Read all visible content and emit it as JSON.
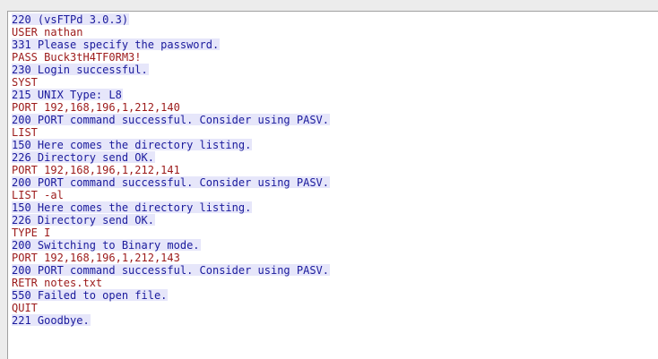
{
  "stream": {
    "lines": [
      {
        "dir": "server",
        "text": "220 (vsFTPd 3.0.3)"
      },
      {
        "dir": "client",
        "text": "USER nathan"
      },
      {
        "dir": "server",
        "text": "331 Please specify the password."
      },
      {
        "dir": "client",
        "text": "PASS Buck3tH4TF0RM3!"
      },
      {
        "dir": "server",
        "text": "230 Login successful."
      },
      {
        "dir": "client",
        "text": "SYST"
      },
      {
        "dir": "server",
        "text": "215 UNIX Type: L8"
      },
      {
        "dir": "client",
        "text": "PORT 192,168,196,1,212,140"
      },
      {
        "dir": "server",
        "text": "200 PORT command successful. Consider using PASV."
      },
      {
        "dir": "client",
        "text": "LIST"
      },
      {
        "dir": "server",
        "text": "150 Here comes the directory listing."
      },
      {
        "dir": "server",
        "text": "226 Directory send OK."
      },
      {
        "dir": "client",
        "text": "PORT 192,168,196,1,212,141"
      },
      {
        "dir": "server",
        "text": "200 PORT command successful. Consider using PASV."
      },
      {
        "dir": "client",
        "text": "LIST -al"
      },
      {
        "dir": "server",
        "text": "150 Here comes the directory listing."
      },
      {
        "dir": "server",
        "text": "226 Directory send OK."
      },
      {
        "dir": "client",
        "text": "TYPE I"
      },
      {
        "dir": "server",
        "text": "200 Switching to Binary mode."
      },
      {
        "dir": "client",
        "text": "PORT 192,168,196,1,212,143"
      },
      {
        "dir": "server",
        "text": "200 PORT command successful. Consider using PASV."
      },
      {
        "dir": "client",
        "text": "RETR notes.txt"
      },
      {
        "dir": "server",
        "text": "550 Failed to open file."
      },
      {
        "dir": "client",
        "text": "QUIT"
      },
      {
        "dir": "server",
        "text": "221 Goodbye."
      }
    ]
  },
  "colors": {
    "server_text": "#1a1a9c",
    "server_bg": "#e6e6fa",
    "client_text": "#9c1a1a",
    "client_bg": "#ffffff"
  }
}
